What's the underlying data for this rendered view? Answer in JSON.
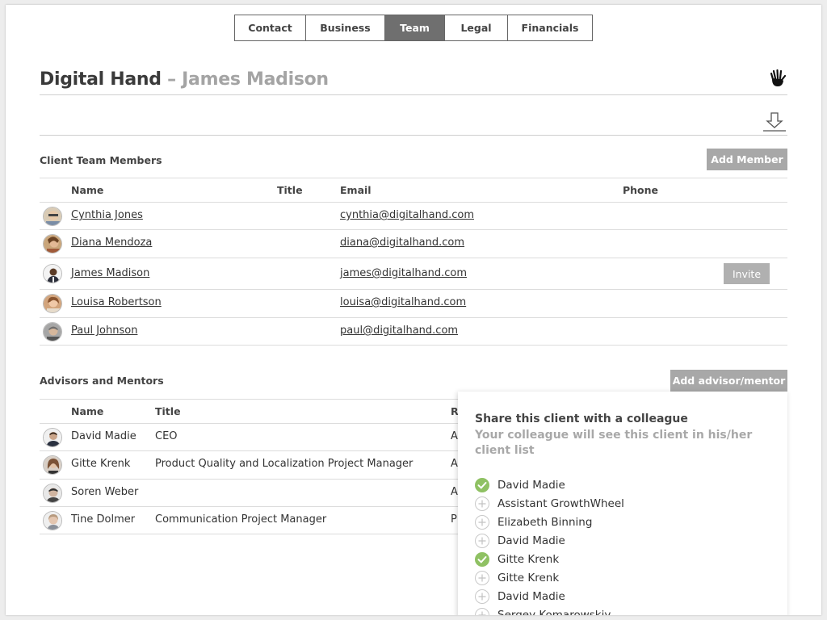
{
  "tabs": [
    "Contact",
    "Business",
    "Team",
    "Legal",
    "Financials"
  ],
  "active_tab": "Team",
  "header": {
    "company": "Digital Hand",
    "separator": " – ",
    "person": "James Madison"
  },
  "client_team": {
    "title": "Client Team Members",
    "add_label": "Add Member",
    "columns": {
      "name": "Name",
      "title": "Title",
      "email": "Email",
      "phone": "Phone"
    },
    "rows": [
      {
        "name": "Cynthia Jones",
        "title": "",
        "email": "cynthia@digitalhand.com",
        "phone": ""
      },
      {
        "name": "Diana Mendoza",
        "title": "",
        "email": "diana@digitalhand.com",
        "phone": ""
      },
      {
        "name": "James Madison",
        "title": "",
        "email": "james@digitalhand.com",
        "phone": "",
        "action": "Invite"
      },
      {
        "name": "Louisa Robertson",
        "title": "",
        "email": "louisa@digitalhand.com",
        "phone": ""
      },
      {
        "name": "Paul Johnson",
        "title": "",
        "email": "paul@digitalhand.com",
        "phone": ""
      }
    ]
  },
  "advisors": {
    "title": "Advisors and Mentors",
    "add_label": "Add advisor/mentor",
    "columns": {
      "name": "Name",
      "title": "Title",
      "role": "R"
    },
    "rows": [
      {
        "name": "David Madie",
        "title": "CEO",
        "role": "A"
      },
      {
        "name": "Gitte Krenk",
        "title": "Product Quality and Localization Project Manager",
        "role": "A"
      },
      {
        "name": "Soren Weber",
        "title": "",
        "role": "A"
      },
      {
        "name": "Tine Dolmer",
        "title": "Communication Project Manager",
        "role": "P"
      }
    ]
  },
  "share": {
    "title": "Share this client with a colleague",
    "subtitle": "Your colleague will see this client in his/her client list",
    "colleagues": [
      {
        "name": "David Madie",
        "checked": true
      },
      {
        "name": "Assistant GrowthWheel",
        "checked": false
      },
      {
        "name": "Elizabeth Binning",
        "checked": false
      },
      {
        "name": "David Madie",
        "checked": false
      },
      {
        "name": "Gitte Krenk",
        "checked": true
      },
      {
        "name": "Gitte Krenk",
        "checked": false
      },
      {
        "name": "David Madie",
        "checked": false
      },
      {
        "name": "Sergey Komarowskiy",
        "checked": false
      }
    ]
  },
  "colors": {
    "active_tab": "#6f6f6f",
    "button_gray": "#a8a8a8",
    "check_green": "#8fc163"
  },
  "icons": {
    "logo": "hand-icon",
    "download": "download-icon"
  }
}
